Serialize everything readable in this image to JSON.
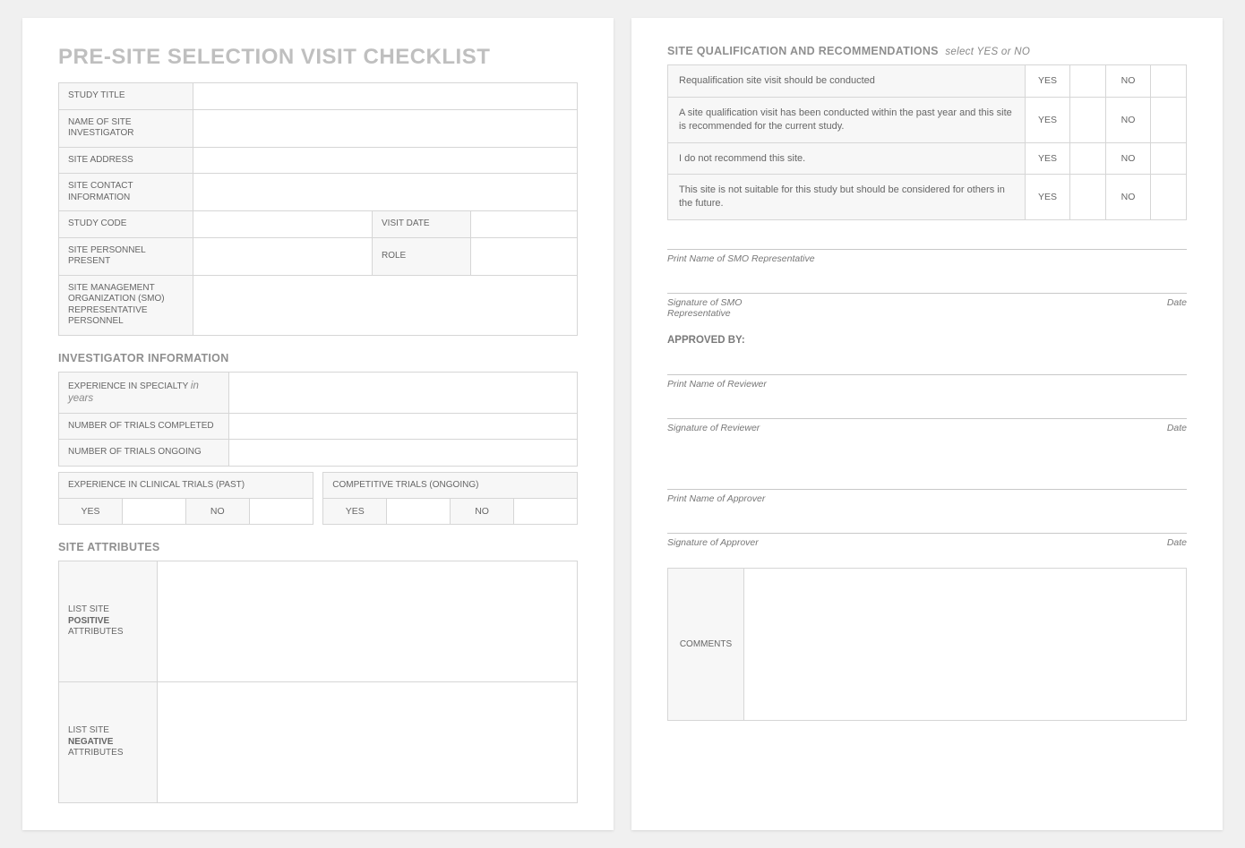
{
  "page1": {
    "title": "PRE-SITE SELECTION VISIT CHECKLIST",
    "basic": {
      "study_title": "STUDY TITLE",
      "investigator_name": "NAME OF SITE INVESTIGATOR",
      "site_address": "SITE ADDRESS",
      "site_contact": "SITE CONTACT INFORMATION",
      "study_code": "STUDY CODE",
      "visit_date": "VISIT DATE",
      "personnel_present": "SITE PERSONNEL PRESENT",
      "role": "ROLE",
      "smo_rep": "SITE MANAGEMENT ORGANIZATION (SMO) REPRESENTATIVE PERSONNEL"
    },
    "investigator": {
      "heading": "INVESTIGATOR INFORMATION",
      "experience_specialty_prefix": "EXPERIENCE IN SPECIALTY ",
      "experience_specialty_suffix": "in years",
      "trials_completed": "NUMBER OF TRIALS COMPLETED",
      "trials_ongoing": "NUMBER OF TRIALS ONGOING",
      "clinical_past": "EXPERIENCE IN CLINICAL TRIALS (PAST)",
      "competitive_ongoing": "COMPETITIVE TRIALS (ONGOING)",
      "yes": "YES",
      "no": "NO"
    },
    "attributes": {
      "heading": "SITE ATTRIBUTES",
      "positive_line1": "LIST SITE",
      "positive_line2": "POSITIVE",
      "positive_line3": "ATTRIBUTES",
      "negative_line1": "LIST SITE",
      "negative_line2": "NEGATIVE",
      "negative_line3": "ATTRIBUTES"
    }
  },
  "page2": {
    "qual": {
      "heading": "SITE QUALIFICATION AND RECOMMENDATIONS",
      "hint": "select YES or NO",
      "items": [
        "Requalification site visit should be conducted",
        "A site qualification visit has been conducted within the past year and this site is recommended for the current study.",
        "I do not recommend this site.",
        "This site is not suitable for this study but should be considered for others in the future."
      ],
      "yes": "YES",
      "no": "NO"
    },
    "signatures": {
      "smo_print": "Print Name of SMO Representative",
      "smo_sign": "Signature of SMO Representative",
      "date": "Date",
      "approved_by": "APPROVED BY:",
      "reviewer_print": "Print Name of Reviewer",
      "reviewer_sign": "Signature of Reviewer",
      "approver_print": "Print Name of Approver",
      "approver_sign": "Signature of Approver"
    },
    "comments_label": "COMMENTS"
  }
}
